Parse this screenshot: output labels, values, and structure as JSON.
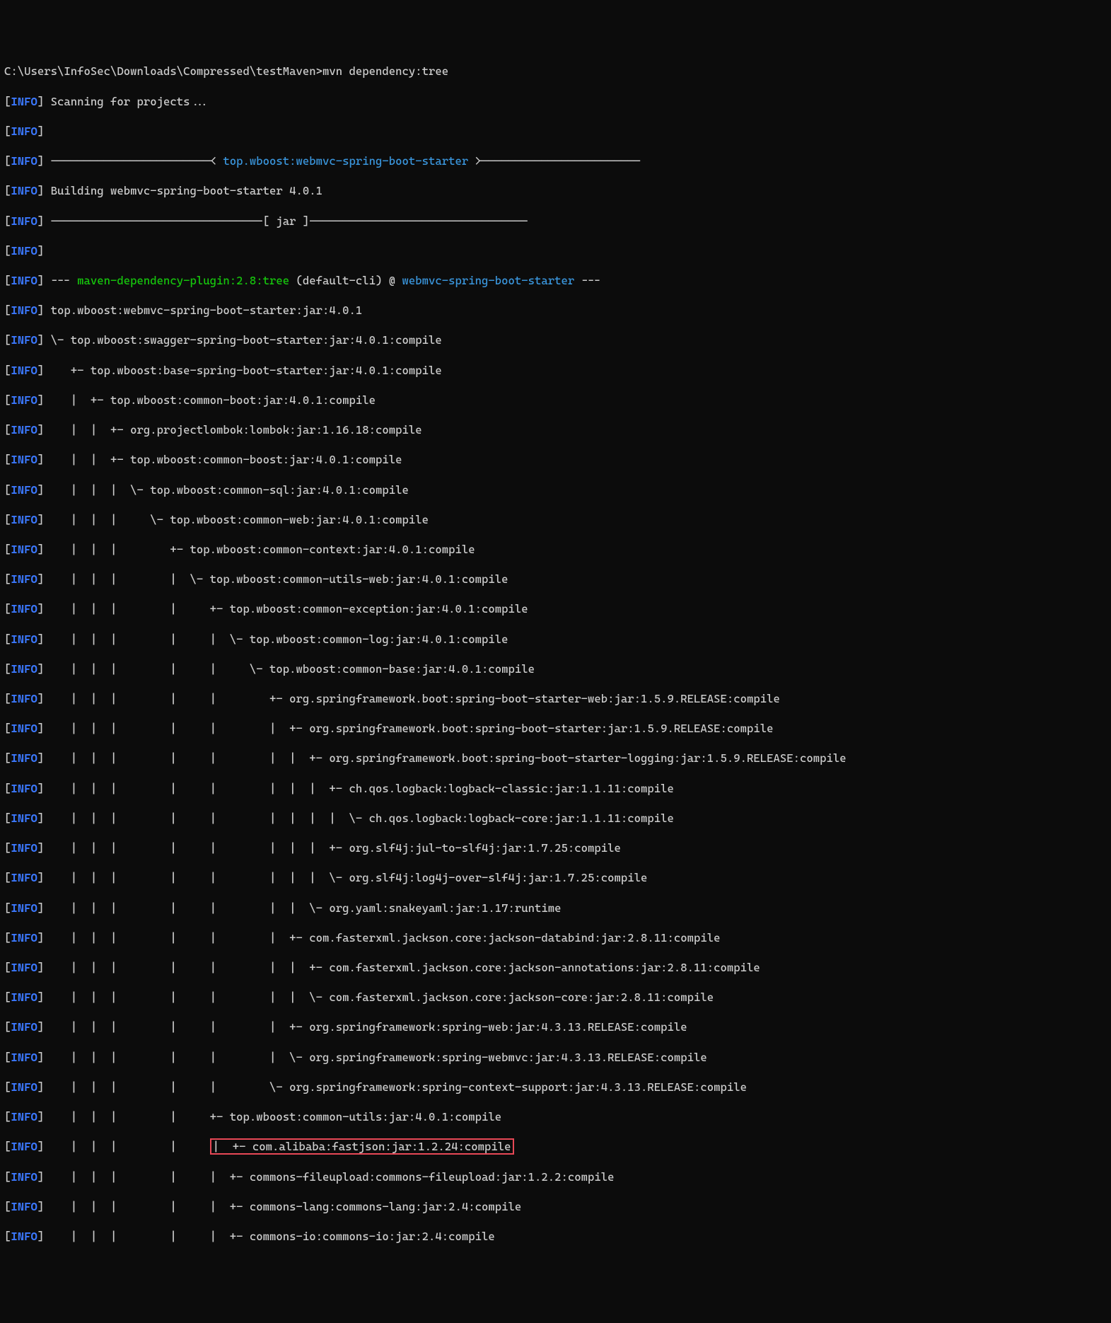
{
  "prompt_line": "C:\\Users\\InfoSec\\Downloads\\Compressed\\testMaven>mvn dependency:tree",
  "info_label": "INFO",
  "lines": {
    "l1": " Scanning for projects...",
    "l2": " ",
    "l3a": " ------------------------< ",
    "l3b": "top.wboost:webmvc-spring-boot-starter",
    "l3c": " >------------------------",
    "l4": " Building webmvc-spring-boot-starter 4.0.1",
    "l5": " --------------------------------[ jar ]---------------------------------",
    "l6": " ",
    "l7a": " --- ",
    "l7b": "maven-dependency-plugin:2.8:tree",
    "l7c": " (default-cli) @ ",
    "l7d": "webmvc-spring-boot-starter",
    "l7e": " ---",
    "l8": " top.wboost:webmvc-spring-boot-starter:jar:4.0.1",
    "l9": " \\- top.wboost:swagger-spring-boot-starter:jar:4.0.1:compile",
    "l10": "    +- top.wboost:base-spring-boot-starter:jar:4.0.1:compile",
    "l11": "    |  +- top.wboost:common-boot:jar:4.0.1:compile",
    "l12": "    |  |  +- org.projectlombok:lombok:jar:1.16.18:compile",
    "l13": "    |  |  +- top.wboost:common-boost:jar:4.0.1:compile",
    "l14": "    |  |  |  \\- top.wboost:common-sql:jar:4.0.1:compile",
    "l15": "    |  |  |     \\- top.wboost:common-web:jar:4.0.1:compile",
    "l16": "    |  |  |        +- top.wboost:common-context:jar:4.0.1:compile",
    "l17": "    |  |  |        |  \\- top.wboost:common-utils-web:jar:4.0.1:compile",
    "l18": "    |  |  |        |     +- top.wboost:common-exception:jar:4.0.1:compile",
    "l19": "    |  |  |        |     |  \\- top.wboost:common-log:jar:4.0.1:compile",
    "l20": "    |  |  |        |     |     \\- top.wboost:common-base:jar:4.0.1:compile",
    "l21": "    |  |  |        |     |        +- org.springframework.boot:spring-boot-starter-web:jar:1.5.9.RELEASE:compile",
    "l22": "    |  |  |        |     |        |  +- org.springframework.boot:spring-boot-starter:jar:1.5.9.RELEASE:compile",
    "l23": "    |  |  |        |     |        |  |  +- org.springframework.boot:spring-boot-starter-logging:jar:1.5.9.RELEASE:compile",
    "l24": "    |  |  |        |     |        |  |  |  +- ch.qos.logback:logback-classic:jar:1.1.11:compile",
    "l25": "    |  |  |        |     |        |  |  |  |  \\- ch.qos.logback:logback-core:jar:1.1.11:compile",
    "l26": "    |  |  |        |     |        |  |  |  +- org.slf4j:jul-to-slf4j:jar:1.7.25:compile",
    "l27": "    |  |  |        |     |        |  |  |  \\- org.slf4j:log4j-over-slf4j:jar:1.7.25:compile",
    "l28": "    |  |  |        |     |        |  |  \\- org.yaml:snakeyaml:jar:1.17:runtime",
    "l29": "    |  |  |        |     |        |  +- com.fasterxml.jackson.core:jackson-databind:jar:2.8.11:compile",
    "l30": "    |  |  |        |     |        |  |  +- com.fasterxml.jackson.core:jackson-annotations:jar:2.8.11:compile",
    "l31": "    |  |  |        |     |        |  |  \\- com.fasterxml.jackson.core:jackson-core:jar:2.8.11:compile",
    "l32": "    |  |  |        |     |        |  +- org.springframework:spring-web:jar:4.3.13.RELEASE:compile",
    "l33": "    |  |  |        |     |        |  \\- org.springframework:spring-webmvc:jar:4.3.13.RELEASE:compile",
    "l34": "    |  |  |        |     |        \\- org.springframework:spring-context-support:jar:4.3.13.RELEASE:compile",
    "l35": "    |  |  |        |     +- top.wboost:common-utils:jar:4.0.1:compile",
    "l36a": "    |  |  |        |     ",
    "l36b": "|  +- com.alibaba:fastjson:jar:1.2.24:compile",
    "l37": "    |  |  |        |     |  +- commons-fileupload:commons-fileupload:jar:1.2.2:compile",
    "l38": "    |  |  |        |     |  +- commons-lang:commons-lang:jar:2.4:compile",
    "l39": "    |  |  |        |     |  +- commons-io:commons-io:jar:2.4:compile"
  }
}
